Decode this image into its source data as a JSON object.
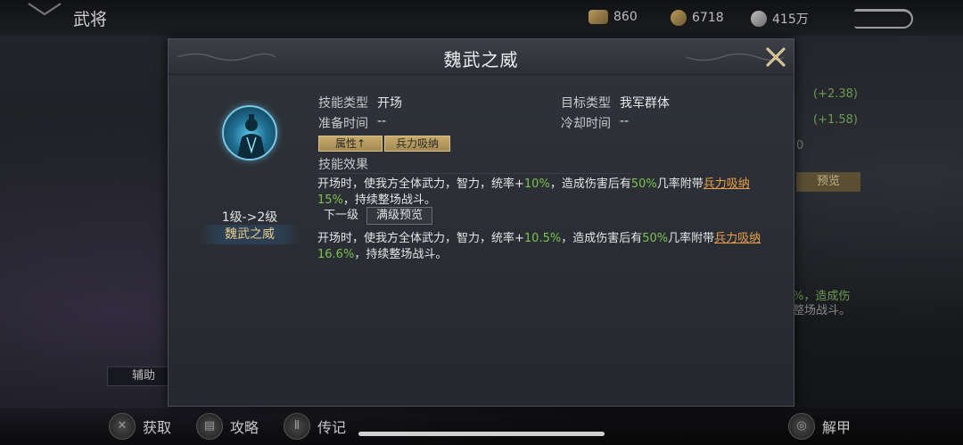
{
  "page": {
    "title": "武将",
    "resources": [
      {
        "icon": "scroll-resource-icon",
        "value": "860"
      },
      {
        "icon": "coin-resource-icon",
        "value": "6718"
      },
      {
        "icon": "silver-resource-icon",
        "value": "415万"
      }
    ]
  },
  "background": {
    "stat_bonus_1": "(+2.38)",
    "stat_bonus_2": "(+1.58)",
    "stat_fragment": "0",
    "preview_label": "预览",
    "text_fragment_1": "%，造成伤",
    "text_fragment_2": "整场战斗。",
    "assist_label": "辅助"
  },
  "bottom_nav": {
    "items": [
      {
        "label": "获取",
        "icon": "crossed-swords-icon"
      },
      {
        "label": "攻略",
        "icon": "book-icon"
      },
      {
        "label": "传记",
        "icon": "scroll-icon"
      },
      {
        "label": "解甲",
        "icon": "armor-icon"
      }
    ]
  },
  "dialog": {
    "title": "魏武之威",
    "close_icon": "close-icon",
    "skill": {
      "level_change": "1级->2级",
      "name": "魏武之威",
      "avatar_icon": "skill-portrait-icon"
    },
    "info": {
      "type_label": "技能类型",
      "type_value": "开场",
      "target_label": "目标类型",
      "target_value": "我军群体",
      "prep_label": "准备时间",
      "prep_value": "--",
      "cooldown_label": "冷却时间",
      "cooldown_value": "--"
    },
    "tags": [
      "属性↑",
      "兵力吸纳"
    ],
    "effect_title": "技能效果",
    "current_effect": {
      "part1": "开场时，使我方全体武力，智力，统率+",
      "pct1": "10%",
      "part2": "，造成伤害后有",
      "pct2": "50%",
      "part3": "几率附带",
      "keyword": "兵力吸纳",
      "pct3": "15%",
      "part4": "，持续整场战斗。"
    },
    "next_level_label": "下一级",
    "max_level_label": "满级预览",
    "next_effect": {
      "part1": "开场时，使我方全体武力，智力，统率+",
      "pct1": "10.5%",
      "part2": "，造成伤害后有",
      "pct2": "50%",
      "part3": "几率附带",
      "keyword": "兵力吸纳",
      "pct3": "16.6%",
      "part4": "，持续整场战斗。"
    }
  }
}
